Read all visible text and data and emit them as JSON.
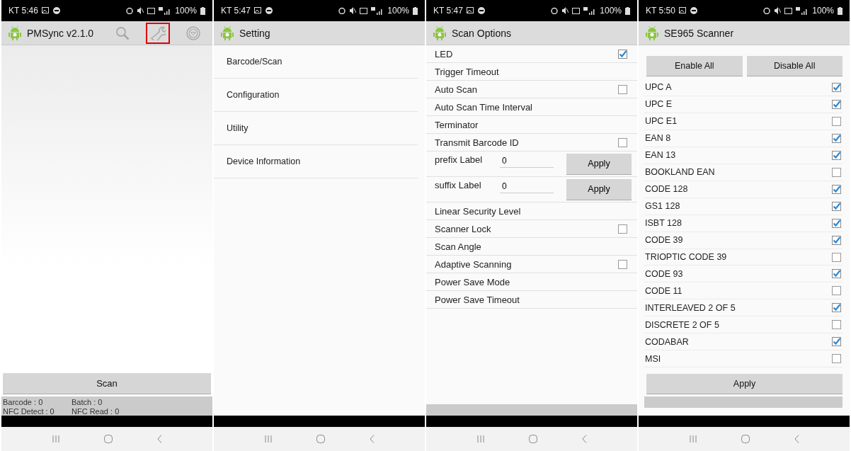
{
  "screens": [
    {
      "kind": "main",
      "status": {
        "carrier_time": "KT 5:46",
        "battery": "100%"
      },
      "title": "PMSync v2.1.0",
      "actions": [
        {
          "highlighted": false
        },
        {
          "highlighted": true
        },
        {
          "highlighted": false
        }
      ],
      "scan_button": "Scan",
      "stats": [
        "Barcode : 0",
        "Batch : 0",
        "NFC Detect : 0",
        "NFC Read : 0"
      ]
    },
    {
      "kind": "menu",
      "status": {
        "carrier_time": "KT 5:47",
        "battery": "100%"
      },
      "title": "Setting",
      "items": [
        "Barcode/Scan",
        "Configuration",
        "Utility",
        "Device Information"
      ]
    },
    {
      "kind": "options",
      "status": {
        "carrier_time": "KT 5:47",
        "battery": "100%"
      },
      "title": "Scan Options",
      "options": [
        {
          "kind": "check",
          "label": "LED",
          "checked": true
        },
        {
          "kind": "plain",
          "label": "Trigger Timeout"
        },
        {
          "kind": "check",
          "label": "Auto Scan",
          "checked": false
        },
        {
          "kind": "plain",
          "label": "Auto Scan Time Interval"
        },
        {
          "kind": "plain",
          "label": "Terminator"
        },
        {
          "kind": "check",
          "label": "Transmit Barcode ID",
          "checked": false
        },
        {
          "kind": "input",
          "label": "prefix Label",
          "value": "0",
          "button": "Apply"
        },
        {
          "kind": "input",
          "label": "suffix Label",
          "value": "0",
          "button": "Apply"
        },
        {
          "kind": "plain",
          "label": "Linear Security Level"
        },
        {
          "kind": "check",
          "label": "Scanner Lock",
          "checked": false
        },
        {
          "kind": "plain",
          "label": "Scan Angle"
        },
        {
          "kind": "check",
          "label": "Adaptive Scanning",
          "checked": false
        },
        {
          "kind": "plain",
          "label": "Power Save Mode"
        },
        {
          "kind": "plain",
          "label": "Power Save Timeout"
        }
      ]
    },
    {
      "kind": "codes",
      "status": {
        "carrier_time": "KT 5:50",
        "battery": "100%"
      },
      "title": "SE965 Scanner",
      "top_buttons": [
        "Enable All",
        "Disable All"
      ],
      "codes": [
        {
          "label": "UPC A",
          "checked": true
        },
        {
          "label": "UPC E",
          "checked": true
        },
        {
          "label": "UPC E1",
          "checked": false
        },
        {
          "label": "EAN 8",
          "checked": true
        },
        {
          "label": "EAN 13",
          "checked": true
        },
        {
          "label": "BOOKLAND EAN",
          "checked": false
        },
        {
          "label": "CODE 128",
          "checked": true
        },
        {
          "label": "GS1 128",
          "checked": true
        },
        {
          "label": "ISBT 128",
          "checked": true
        },
        {
          "label": "CODE 39",
          "checked": true
        },
        {
          "label": "TRIOPTIC CODE 39",
          "checked": false
        },
        {
          "label": "CODE 93",
          "checked": true
        },
        {
          "label": "CODE 11",
          "checked": false
        },
        {
          "label": "INTERLEAVED 2 OF 5",
          "checked": true
        },
        {
          "label": "DISCRETE 2 OF 5",
          "checked": false
        },
        {
          "label": "CODABAR",
          "checked": true
        },
        {
          "label": "MSI",
          "checked": false
        }
      ],
      "apply_button": "Apply"
    }
  ]
}
